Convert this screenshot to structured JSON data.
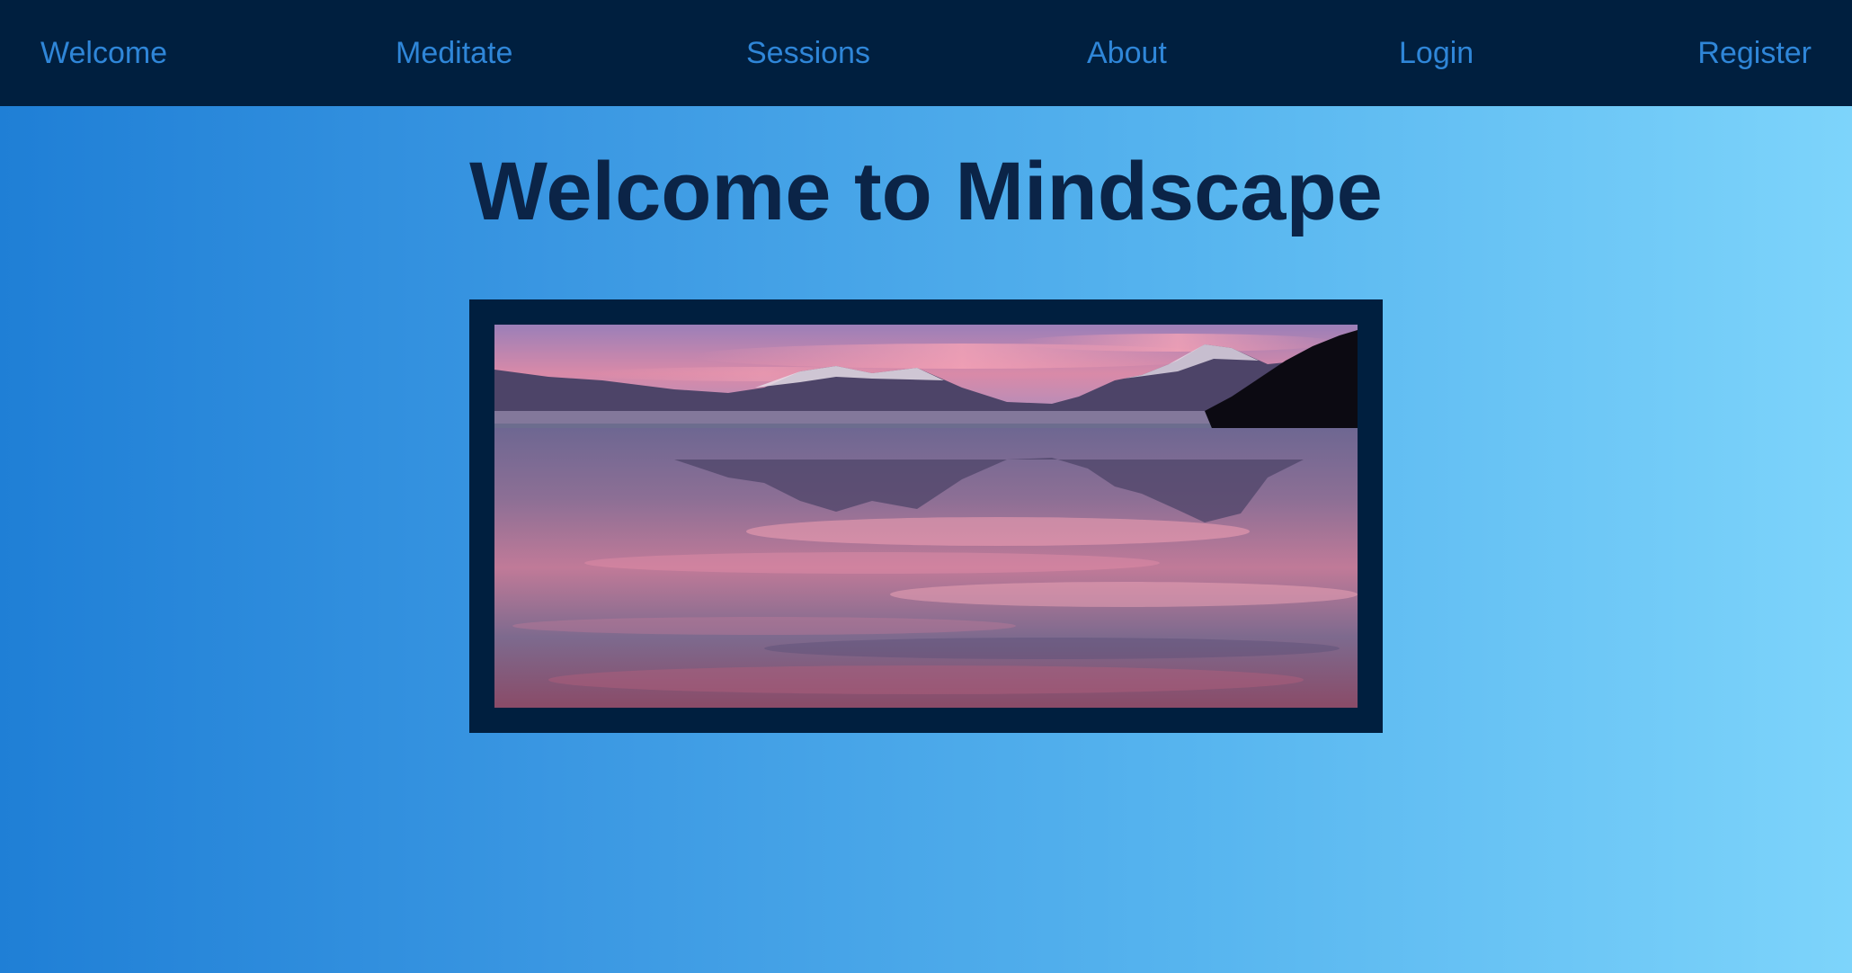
{
  "nav": {
    "items": [
      {
        "label": "Welcome"
      },
      {
        "label": "Meditate"
      },
      {
        "label": "Sessions"
      },
      {
        "label": "About"
      },
      {
        "label": "Login"
      },
      {
        "label": "Register"
      }
    ]
  },
  "main": {
    "title": "Welcome to Mindscape"
  },
  "colors": {
    "navbar_bg": "#001f3f",
    "nav_link": "#2f86d8",
    "title": "#0b2447",
    "gradient_start": "#1f7fd6",
    "gradient_end": "#7dd4fb"
  }
}
